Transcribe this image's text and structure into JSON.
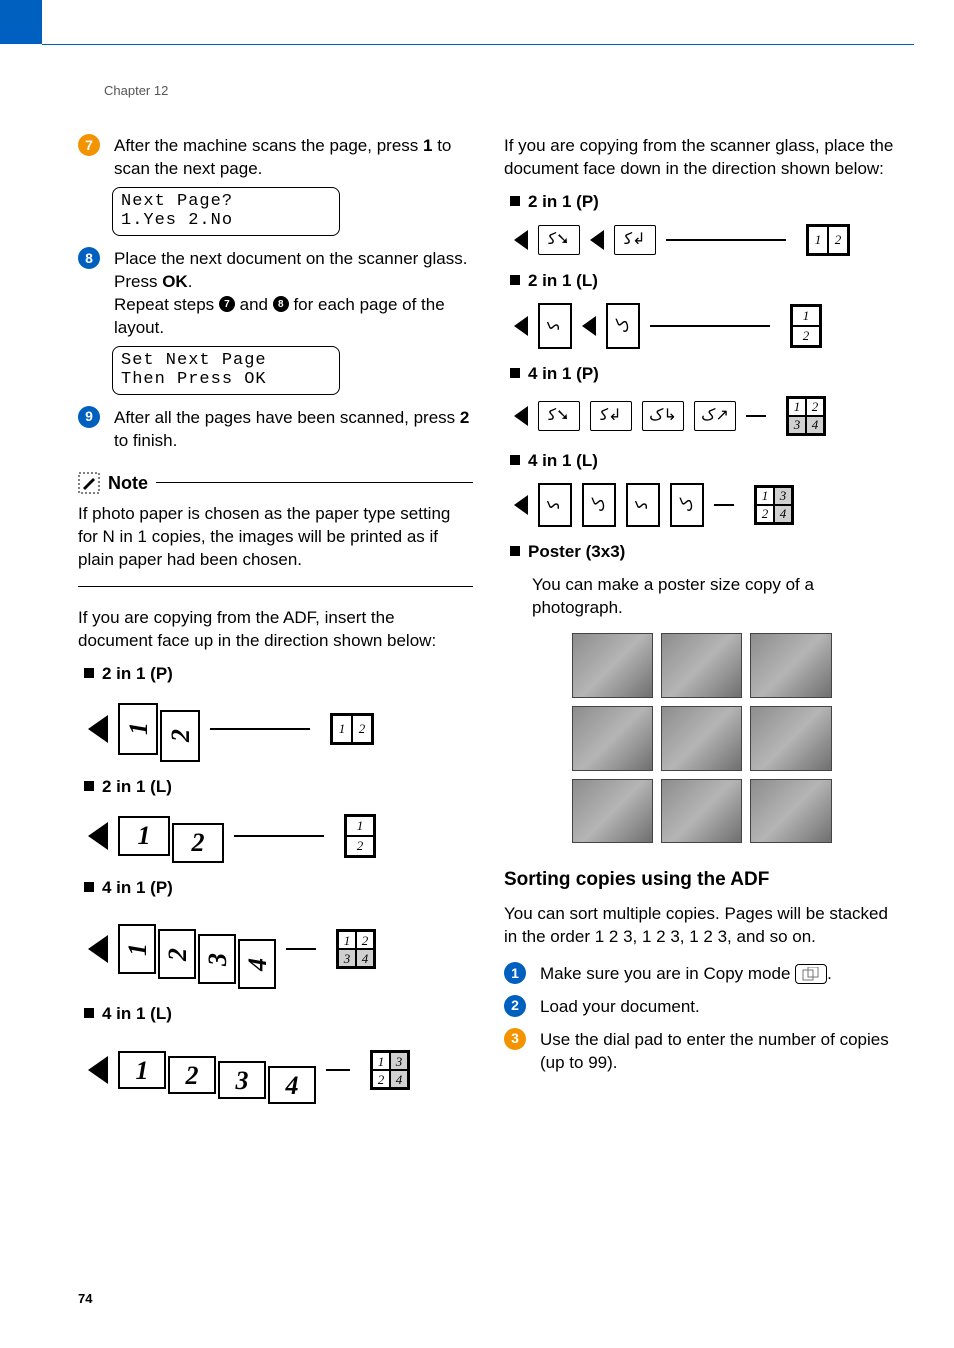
{
  "chapter_label": "Chapter 12",
  "page_number": "74",
  "steps": {
    "s7": {
      "num": "7",
      "text_a": "After the machine scans the page, press ",
      "bold_1": "1",
      "text_b": " to scan the next page."
    },
    "lcd1_l1": "Next Page?",
    "lcd1_l2": "1.Yes 2.No",
    "s8": {
      "num": "8",
      "line1_a": "Place the next document on the scanner glass. Press ",
      "bold_ok": "OK",
      "line1_b": ".",
      "line2_a": "Repeat steps ",
      "b1": "7",
      "mid": " and ",
      "b2": "8",
      "line2_b": " for each page of the layout."
    },
    "lcd2_l1": "Set Next Page",
    "lcd2_l2": "Then Press OK",
    "s9": {
      "num": "9",
      "text_a": "After all the pages have been scanned, press ",
      "bold_2": "2",
      "text_b": " to finish."
    }
  },
  "note": {
    "title": "Note",
    "body": "If photo paper is chosen as the paper type setting for N in 1 copies,  the images will be printed as if plain paper had been chosen."
  },
  "adf_intro": "If you are copying from the ADF, insert the document face up in the direction shown below:",
  "labels": {
    "p2": "2 in 1 (P)",
    "l2": "2 in 1 (L)",
    "p4": "4 in 1 (P)",
    "l4": "4 in 1 (L)",
    "poster": "Poster (3x3)"
  },
  "glass_intro": "If you are copying from the scanner glass, place the document face down in the direction shown below:",
  "poster_text": "You can make a poster size copy of a photograph.",
  "sort": {
    "heading": "Sorting copies using the ADF",
    "intro": "You can sort multiple copies. Pages will be stacked in the order 1 2 3, 1 2 3, 1 2 3, and so on.",
    "s1": {
      "num": "1",
      "text": "Make sure you are in Copy mode ",
      "tail": "."
    },
    "s2": {
      "num": "2",
      "text": "Load your document."
    },
    "s3": {
      "num": "3",
      "text": "Use the dial pad to enter the number of copies (up to 99)."
    }
  }
}
